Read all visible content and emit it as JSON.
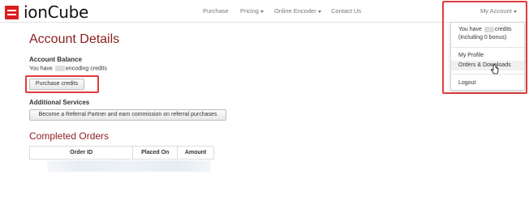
{
  "brand": {
    "name": "ionCube",
    "color": "#d81e1e"
  },
  "nav": {
    "items": [
      {
        "label": "Purchase"
      },
      {
        "label": "Pricing",
        "has_caret": true
      },
      {
        "label": "Online Encoder",
        "has_caret": true
      },
      {
        "label": "Contact Us"
      }
    ],
    "account": {
      "label": "My Account",
      "has_caret": true
    }
  },
  "account_menu": {
    "credits_prefix": "You have",
    "credits_suffix": "credits",
    "bonus": "(including 0 bonus)",
    "my_profile": "My Profile",
    "orders_downloads": "Orders & Downloads",
    "logout": "Logout"
  },
  "page": {
    "title": "Account Details",
    "balance_heading": "Account Balance",
    "balance_prefix": "You have",
    "balance_suffix": "encoding credits",
    "purchase_button": "Purchase credits",
    "services_heading": "Additional Services",
    "referral_button": "Become a Referral Partner and earn commission on referral purchases"
  },
  "orders": {
    "title": "Completed Orders",
    "columns": [
      "Order ID",
      "Placed On",
      "Amount"
    ]
  },
  "colors": {
    "heading": "#8b1d1d",
    "highlight": "#e13c3c"
  },
  "icons": [
    "brand-logo-icon",
    "caret-down-icon",
    "hand-pointer-cursor-icon"
  ]
}
